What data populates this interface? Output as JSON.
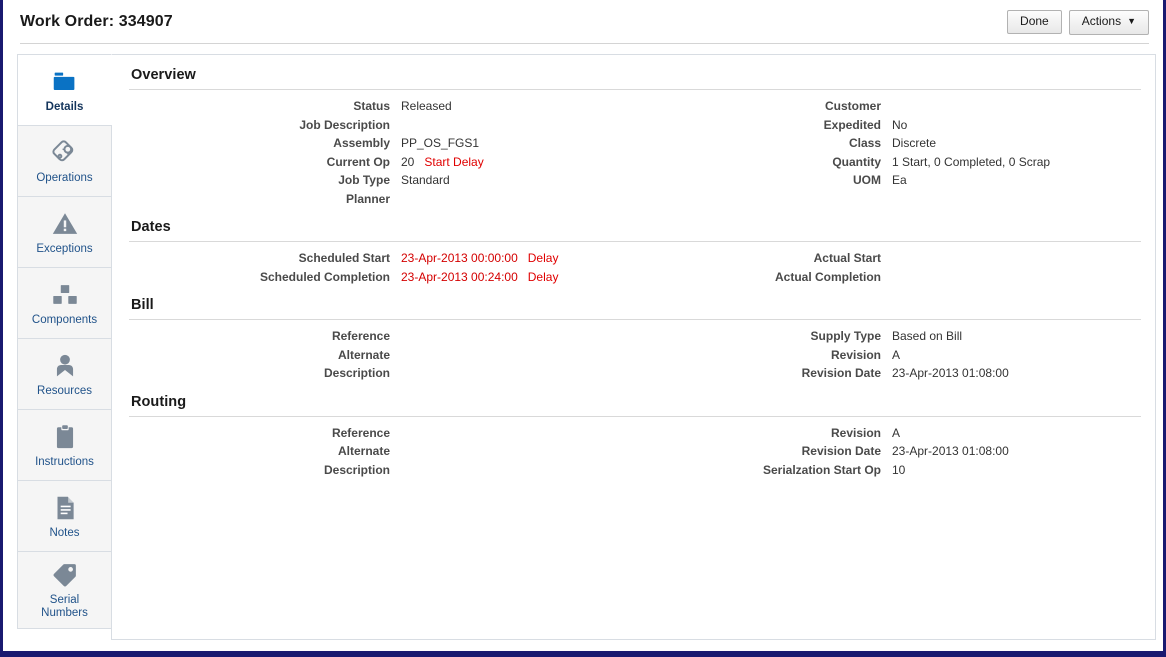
{
  "header": {
    "title": "Work Order: 334907",
    "buttons": [
      {
        "name": "done-button",
        "label": "Done"
      },
      {
        "name": "actions-button",
        "label": "Actions",
        "caret": "▼"
      }
    ]
  },
  "tabs": [
    {
      "label": "Details",
      "icon": "folder-icon",
      "active": true
    },
    {
      "label": "Operations",
      "icon": "gear-tag-icon",
      "active": false
    },
    {
      "label": "Exceptions",
      "icon": "warning-triangle-icon",
      "active": false
    },
    {
      "label": "Components",
      "icon": "blocks-icon",
      "active": false
    },
    {
      "label": "Resources",
      "icon": "person-icon",
      "active": false
    },
    {
      "label": "Instructions",
      "icon": "clipboard-icon",
      "active": false
    },
    {
      "label": "Notes",
      "icon": "document-lines-icon",
      "active": false
    },
    {
      "label": "Serial\nNumbers",
      "icon": "tag-icon",
      "active": false
    }
  ],
  "sections": [
    {
      "title": "Overview",
      "left": [
        {
          "label": "Status",
          "value": "Released",
          "tag": ""
        },
        {
          "label": "Job Description",
          "value": "",
          "tag": ""
        },
        {
          "label": "Assembly",
          "value": "PP_OS_FGS1",
          "tag": ""
        },
        {
          "label": "Current Op",
          "value": "20",
          "tag": "Start Delay"
        },
        {
          "label": "Job Type",
          "value": "Standard",
          "tag": ""
        },
        {
          "label": "Planner",
          "value": "",
          "tag": ""
        }
      ],
      "right": [
        {
          "label": "Customer",
          "value": "",
          "tag": ""
        },
        {
          "label": "Expedited",
          "value": "No",
          "tag": ""
        },
        {
          "label": "Class",
          "value": "Discrete",
          "tag": ""
        },
        {
          "label": "Quantity",
          "value": "1 Start, 0 Completed, 0 Scrap",
          "tag": ""
        },
        {
          "label": "UOM",
          "value": "Ea",
          "tag": ""
        }
      ]
    },
    {
      "title": "Dates",
      "left": [
        {
          "label": "Scheduled Start",
          "value": "23-Apr-2013 00:00:00",
          "value_color": "red",
          "tag": "Delay"
        },
        {
          "label": "Scheduled Completion",
          "value": "23-Apr-2013 00:24:00",
          "value_color": "red",
          "tag": "Delay"
        }
      ],
      "right": [
        {
          "label": "Actual Start",
          "value": "",
          "tag": ""
        },
        {
          "label": "Actual Completion",
          "value": "",
          "tag": ""
        }
      ]
    },
    {
      "title": "Bill",
      "left": [
        {
          "label": "Reference",
          "value": "",
          "tag": ""
        },
        {
          "label": "Alternate",
          "value": "",
          "tag": ""
        },
        {
          "label": "Description",
          "value": "",
          "tag": ""
        }
      ],
      "right": [
        {
          "label": "Supply Type",
          "value": "Based on Bill",
          "tag": ""
        },
        {
          "label": "Revision",
          "value": "A",
          "tag": ""
        },
        {
          "label": "Revision Date",
          "value": "23-Apr-2013 01:08:00",
          "tag": ""
        }
      ]
    },
    {
      "title": "Routing",
      "left": [
        {
          "label": "Reference",
          "value": "",
          "tag": ""
        },
        {
          "label": "Alternate",
          "value": "",
          "tag": ""
        },
        {
          "label": "Description",
          "value": "",
          "tag": ""
        }
      ],
      "right": [
        {
          "label": "Revision",
          "value": "A",
          "tag": ""
        },
        {
          "label": "Revision Date",
          "value": "23-Apr-2013 01:08:00",
          "tag": ""
        },
        {
          "label": "Serialzation Start Op",
          "value": "10",
          "tag": ""
        }
      ]
    }
  ],
  "colors": {
    "page_border": "#191970",
    "tab_link": "#21538a",
    "accent_blue": "#0a72c4",
    "alert_red": "#d40000",
    "icon_gray": "#7b8896"
  }
}
